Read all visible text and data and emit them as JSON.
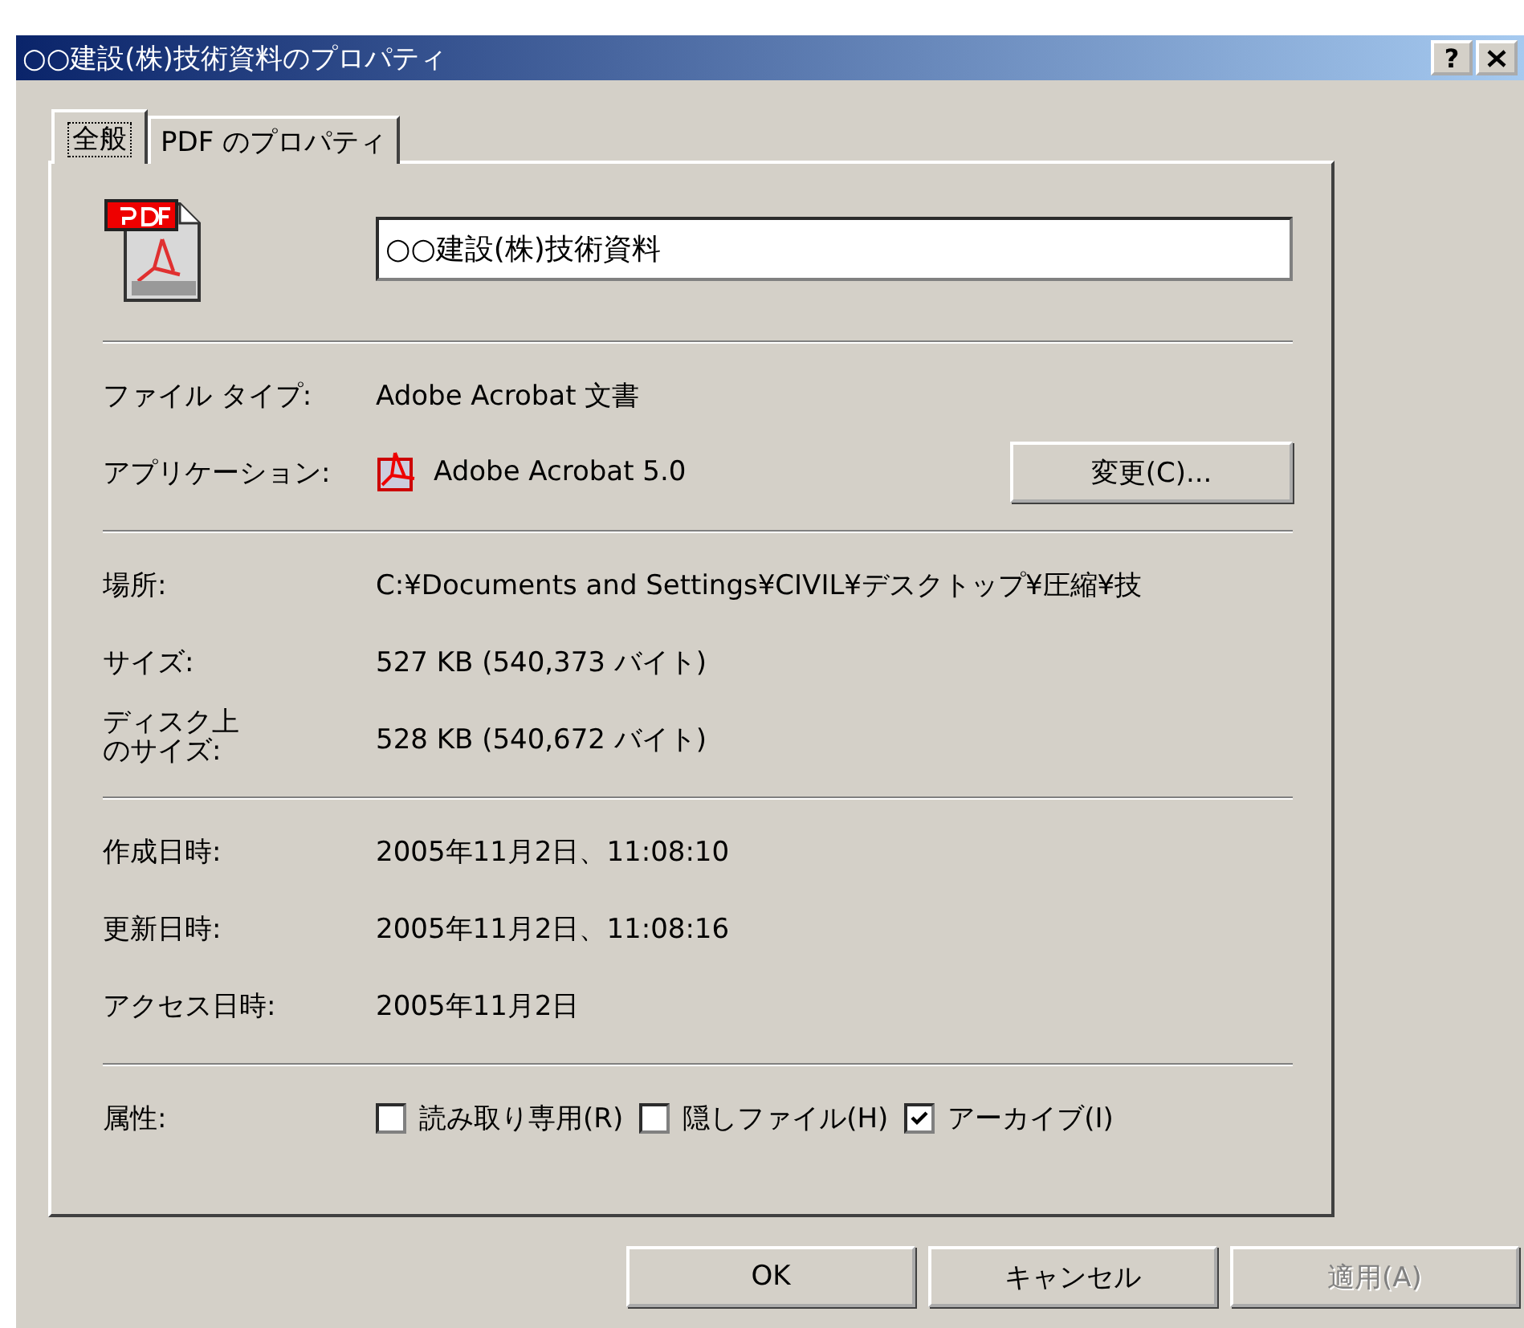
{
  "window": {
    "title": "○○建設(株)技術資料のプロパティ",
    "help": "?"
  },
  "tabs": [
    {
      "label": "全般",
      "selected": true
    },
    {
      "label": "PDF のプロパティ",
      "selected": false
    }
  ],
  "file_name": "○○建設(株)技術資料",
  "sections": [
    [
      {
        "kind": "text",
        "label": "ファイル タイプ:",
        "value": "Adobe Acrobat 文書"
      },
      {
        "kind": "app",
        "label": "アプリケーション:",
        "value": "Adobe Acrobat 5.0",
        "button": "変更(C)..."
      }
    ],
    [
      {
        "kind": "text",
        "label": "場所:",
        "value": "C:¥Documents and Settings¥CIVIL¥デスクトップ¥圧縮¥技"
      },
      {
        "kind": "text",
        "label": "サイズ:",
        "value": "527 KB (540,373 バイト)"
      },
      {
        "kind": "text",
        "label": [
          "ディスク上",
          "のサイズ:"
        ],
        "value": "528 KB (540,672 バイト)"
      }
    ],
    [
      {
        "kind": "text",
        "label": "作成日時:",
        "value": "2005年11月2日、11:08:10"
      },
      {
        "kind": "text",
        "label": "更新日時:",
        "value": "2005年11月2日、11:08:16"
      },
      {
        "kind": "text",
        "label": "アクセス日時:",
        "value": "2005年11月2日"
      }
    ],
    [
      {
        "kind": "attributes",
        "label": "属性:",
        "options": [
          {
            "label": "読み取り専用(R)",
            "checked": false
          },
          {
            "label": "隠しファイル(H)",
            "checked": false
          },
          {
            "label": "アーカイブ(I)",
            "checked": true
          }
        ]
      }
    ]
  ],
  "buttons": [
    {
      "label": "OK",
      "disabled": false
    },
    {
      "label": "キャンセル",
      "disabled": false
    },
    {
      "label": "適用(A)",
      "disabled": true
    }
  ]
}
